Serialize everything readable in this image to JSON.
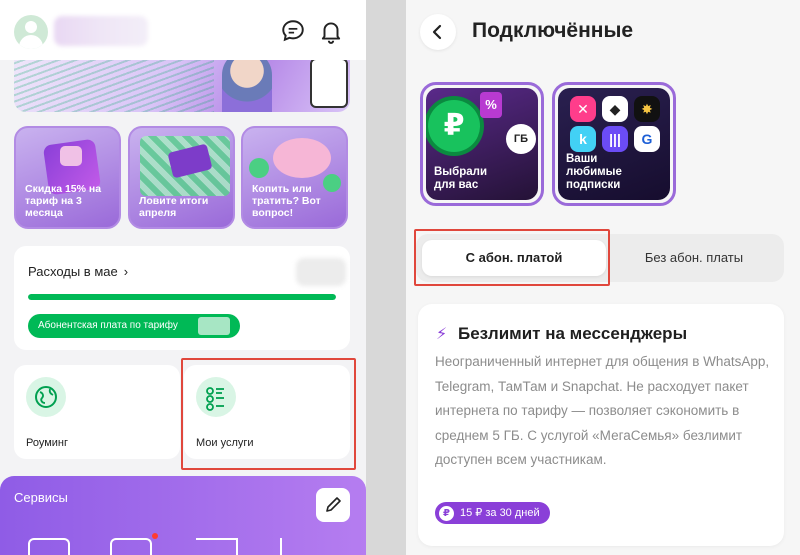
{
  "left": {
    "tiles": [
      {
        "caption": "Скидка 15% на тариф на 3 месяца"
      },
      {
        "caption": "Ловите итоги апреля"
      },
      {
        "caption": "Копить или тратить? Вот вопрос!"
      }
    ],
    "expenses": {
      "title": "Расходы в мае",
      "chevron": "›",
      "fee_label": "Абонентская плата по тарифу",
      "progress": 1.0
    },
    "quick_services": [
      {
        "label": "Роуминг",
        "icon": "globe-icon"
      },
      {
        "label": "Мои услуги",
        "icon": "services-list-icon"
      }
    ],
    "services": {
      "title": "Сервисы"
    },
    "colors": {
      "accent_green": "#00b956",
      "accent_purple": "#8a3fd8",
      "highlight": "#e0473c"
    }
  },
  "right": {
    "title": "Подключённые",
    "stories": [
      {
        "caption": "Выбрали для вас",
        "icons": {
          "ruble": "₽",
          "percent": "%",
          "gb": "ГБ"
        }
      },
      {
        "caption": "Ваши любимые подписки"
      }
    ],
    "segments": [
      {
        "label": "С абон. платой",
        "active": true
      },
      {
        "label": "Без абон. платы",
        "active": false
      }
    ],
    "feature": {
      "title": "Безлимит на мессенджеры",
      "description": "Неограниченный интернет для общения в WhatsApp, Telegram, ТамТам и Snapchat. Не расходует пакет интернета по тарифу — позволяет сэкономить в среднем 5 ГБ. С услугой «МегаСемья» безлимит доступен всем участникам.",
      "price": "15 ₽ за 30 дней",
      "price_icon": "₽"
    }
  }
}
